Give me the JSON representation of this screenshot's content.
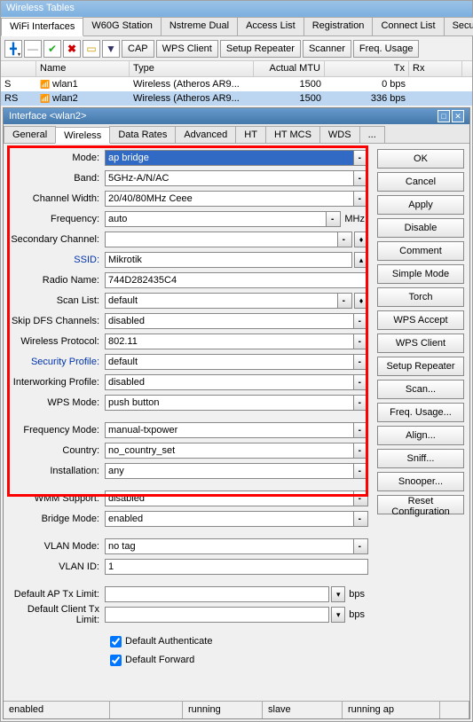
{
  "window_title": "Wireless Tables",
  "main_tabs": [
    "WiFi Interfaces",
    "W60G Station",
    "Nstreme Dual",
    "Access List",
    "Registration",
    "Connect List",
    "Security Profile"
  ],
  "toolbar": {
    "cap": "CAP",
    "wps_client": "WPS Client",
    "setup_repeater": "Setup Repeater",
    "scanner": "Scanner",
    "freq_usage": "Freq. Usage"
  },
  "grid": {
    "headers": {
      "name": "Name",
      "type": "Type",
      "mtu": "Actual MTU",
      "tx": "Tx",
      "rx": "Rx"
    },
    "rows": [
      {
        "flag": "S",
        "name": "wlan1",
        "type": "Wireless (Atheros AR9...",
        "mtu": "1500",
        "tx": "0 bps",
        "rx": ""
      },
      {
        "flag": "RS",
        "name": "wlan2",
        "type": "Wireless (Atheros AR9...",
        "mtu": "1500",
        "tx": "336 bps",
        "rx": ""
      }
    ]
  },
  "sub_window_title": "Interface <wlan2>",
  "sub_tabs": [
    "General",
    "Wireless",
    "Data Rates",
    "Advanced",
    "HT",
    "HT MCS",
    "WDS",
    "..."
  ],
  "form": {
    "mode": {
      "label": "Mode:",
      "value": "ap bridge"
    },
    "band": {
      "label": "Band:",
      "value": "5GHz-A/N/AC"
    },
    "channel_width": {
      "label": "Channel Width:",
      "value": "20/40/80MHz Ceee"
    },
    "frequency": {
      "label": "Frequency:",
      "value": "auto",
      "unit": "MHz"
    },
    "secondary_channel": {
      "label": "Secondary Channel:",
      "value": ""
    },
    "ssid": {
      "label": "SSID:",
      "value": "Mikrotik"
    },
    "radio_name": {
      "label": "Radio Name:",
      "value": "744D282435C4"
    },
    "scan_list": {
      "label": "Scan List:",
      "value": "default"
    },
    "skip_dfs": {
      "label": "Skip DFS Channels:",
      "value": "disabled"
    },
    "wireless_protocol": {
      "label": "Wireless Protocol:",
      "value": "802.11"
    },
    "security_profile": {
      "label": "Security Profile:",
      "value": "default"
    },
    "interworking": {
      "label": "Interworking Profile:",
      "value": "disabled"
    },
    "wps_mode": {
      "label": "WPS Mode:",
      "value": "push button"
    },
    "frequency_mode": {
      "label": "Frequency Mode:",
      "value": "manual-txpower"
    },
    "country": {
      "label": "Country:",
      "value": "no_country_set"
    },
    "installation": {
      "label": "Installation:",
      "value": "any"
    },
    "wmm": {
      "label": "WMM Support:",
      "value": "disabled"
    },
    "bridge_mode": {
      "label": "Bridge Mode:",
      "value": "enabled"
    },
    "vlan_mode": {
      "label": "VLAN Mode:",
      "value": "no tag"
    },
    "vlan_id": {
      "label": "VLAN ID:",
      "value": "1"
    },
    "default_ap_tx": {
      "label": "Default AP Tx Limit:",
      "value": "",
      "unit": "bps"
    },
    "default_client_tx": {
      "label": "Default Client Tx Limit:",
      "value": "",
      "unit": "bps"
    },
    "default_auth": "Default Authenticate",
    "default_forward": "Default Forward"
  },
  "side": {
    "ok": "OK",
    "cancel": "Cancel",
    "apply": "Apply",
    "disable": "Disable",
    "comment": "Comment",
    "simple_mode": "Simple Mode",
    "torch": "Torch",
    "wps_accept": "WPS Accept",
    "wps_client": "WPS Client",
    "setup_repeater": "Setup Repeater",
    "scan": "Scan...",
    "freq_usage": "Freq. Usage...",
    "align": "Align...",
    "sniff": "Sniff...",
    "snooper": "Snooper...",
    "reset": "Reset Configuration"
  },
  "status": [
    "enabled",
    "",
    "running",
    "slave",
    "running ap",
    ""
  ]
}
